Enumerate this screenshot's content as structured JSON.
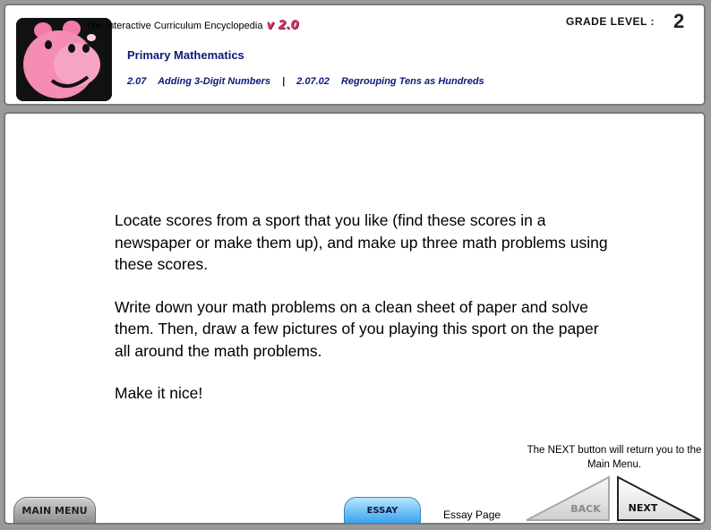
{
  "header": {
    "app_title": "The Interactive Curriculum Encyclopedia",
    "version": "v 2.0",
    "subject": "Primary Mathematics",
    "breadcrumb": {
      "chapter_number": "2.07",
      "chapter_title": "Adding 3-Digit Numbers",
      "separator": "|",
      "section_number": "2.07.02",
      "section_title": "Regrouping Tens as Hundreds"
    },
    "grade_label": "GRADE  LEVEL :",
    "grade_value": "2",
    "logo_icon": "pink-hippo-mascot-icon"
  },
  "content": {
    "paragraphs": [
      "Locate scores from a sport that you like (find these scores in a newspaper or make them up), and make up three math problems using these scores.",
      "Write down your math problems on a clean sheet of paper and solve them. Then, draw a few pictures of you playing this sport on the paper all around the math problems.",
      "Make it nice!"
    ]
  },
  "footer": {
    "note": "The NEXT button will return you to the Main Menu.",
    "main_menu_label": "MAIN MENU",
    "essay_label": "ESSAY",
    "page_label": "Essay Page",
    "back_label": "BACK",
    "next_label": "NEXT"
  },
  "colors": {
    "breadcrumb": "#0b1a78",
    "version": "#d23a6a",
    "essay_button": "#3aa4ee"
  }
}
